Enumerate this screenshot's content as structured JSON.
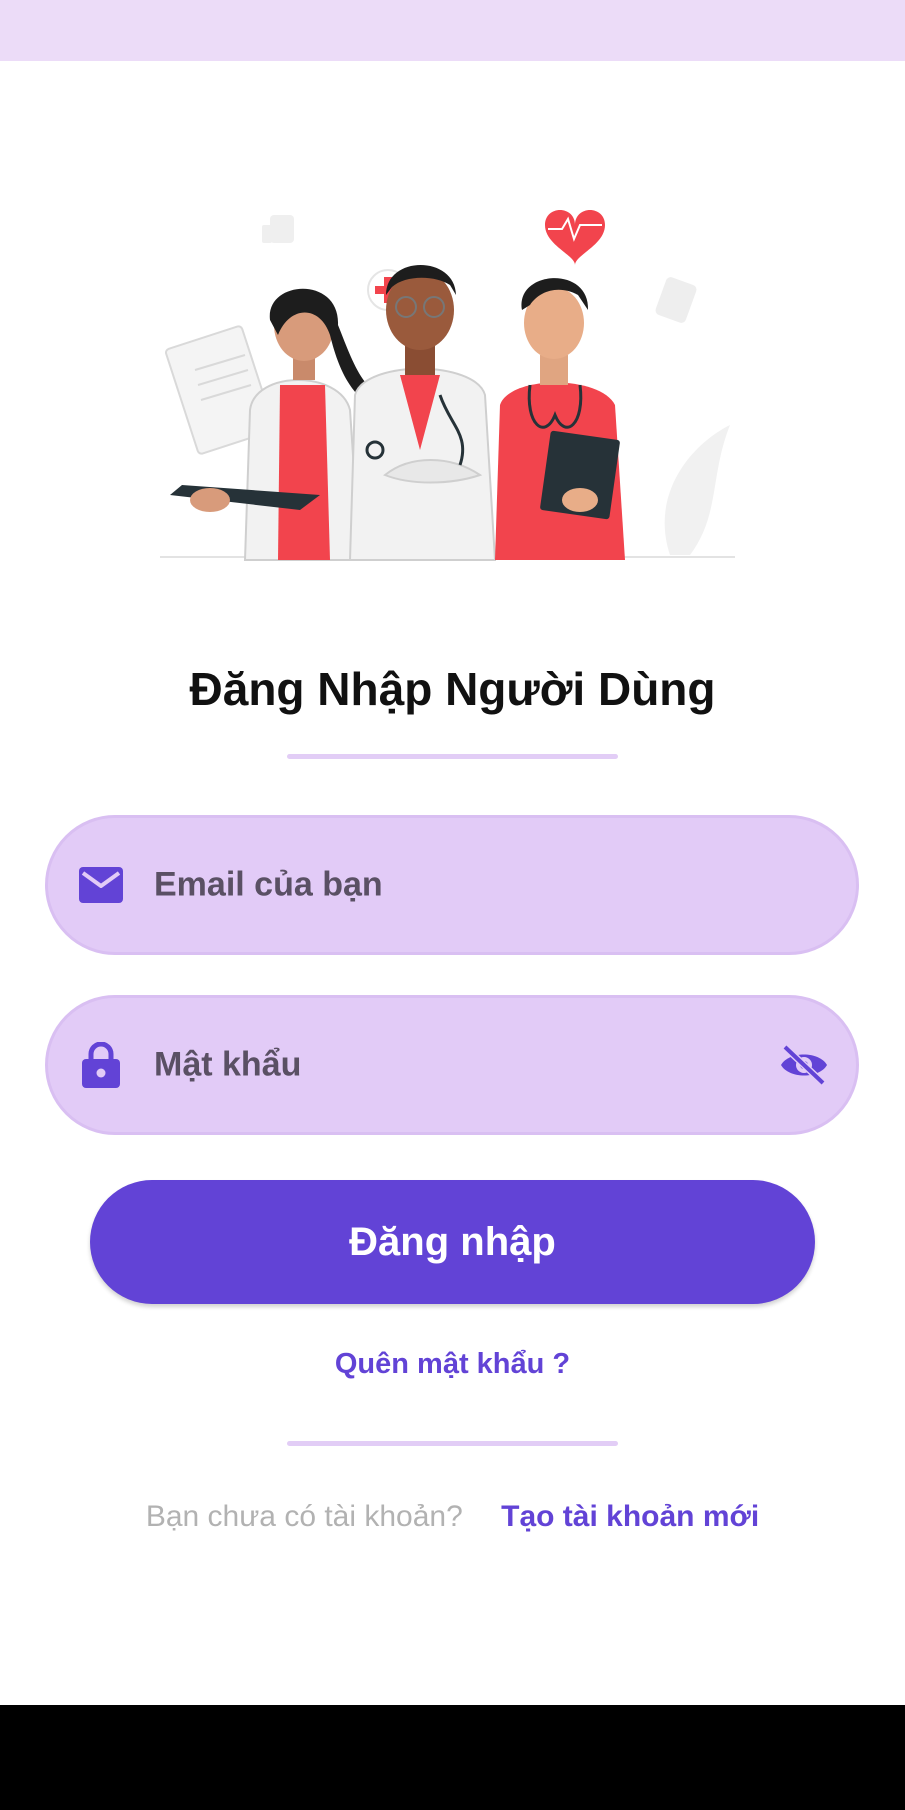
{
  "title": "Đăng Nhập Người Dùng",
  "email_field": {
    "placeholder": "Email của bạn",
    "icon": "mail-icon"
  },
  "password_field": {
    "placeholder": "Mật khẩu",
    "icon": "lock-icon",
    "toggle_icon": "eye-off-icon"
  },
  "login_button": {
    "label": "Đăng nhập"
  },
  "forgot_password": "Quên mật khẩu ?",
  "signup": {
    "question": "Bạn chưa có tài khoản?",
    "link": "Tạo tài khoản mới"
  },
  "colors": {
    "primary": "#6243d6",
    "field_bg": "#e2cbf7",
    "status_bar": "#ecdcf8",
    "accent_red": "#f2444d"
  }
}
